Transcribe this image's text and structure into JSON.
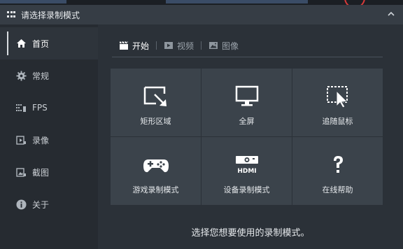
{
  "window": {
    "title": "请选择录制模式"
  },
  "sidebar": {
    "items": [
      {
        "label": "首页",
        "icon": "home-icon",
        "active": true
      },
      {
        "label": "常规",
        "icon": "gear-icon",
        "active": false
      },
      {
        "label": "FPS",
        "icon": "fps-icon",
        "active": false
      },
      {
        "label": "录像",
        "icon": "video-record-icon",
        "active": false
      },
      {
        "label": "截图",
        "icon": "screenshot-icon",
        "active": false
      },
      {
        "label": "关于",
        "icon": "info-icon",
        "active": false
      }
    ]
  },
  "tabs": [
    {
      "label": "开始",
      "icon": "clapperboard-icon",
      "active": true
    },
    {
      "label": "视频",
      "icon": "video-icon",
      "active": false
    },
    {
      "label": "图像",
      "icon": "image-icon",
      "active": false
    }
  ],
  "modes": [
    {
      "label": "矩形区域",
      "icon": "rectangle-area-icon"
    },
    {
      "label": "全屏",
      "icon": "monitor-icon"
    },
    {
      "label": "追随鼠标",
      "icon": "follow-mouse-icon"
    },
    {
      "label": "游戏录制模式",
      "icon": "gamepad-icon"
    },
    {
      "label": "设备录制模式",
      "icon": "hdmi-device-icon"
    },
    {
      "label": "在线帮助",
      "icon": "help-icon"
    }
  ],
  "hint": "选择您想要使用的录制模式。",
  "colors": {
    "background": "#2b3138",
    "sidebar": "#262b31",
    "tile": "#3b434b",
    "record_accent": "#d83a3a"
  }
}
